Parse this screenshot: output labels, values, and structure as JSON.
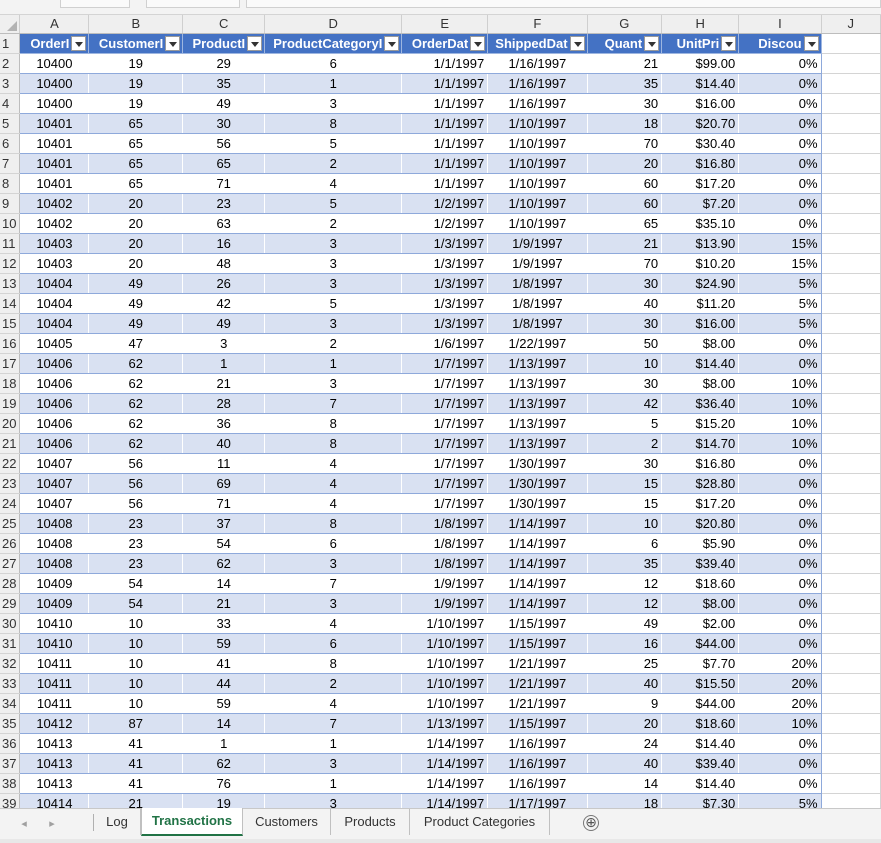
{
  "columns": [
    "A",
    "B",
    "C",
    "D",
    "E",
    "F",
    "G",
    "H",
    "I",
    "J"
  ],
  "headers": [
    "OrderI",
    "CustomerI",
    "ProductI",
    "ProductCategoryI",
    "OrderDat",
    "ShippedDat",
    "Quant",
    "UnitPri",
    "Discou"
  ],
  "rows": [
    [
      "10400",
      "19",
      "29",
      "6",
      "1/1/1997",
      "1/16/1997",
      "21",
      "$99.00",
      "0%"
    ],
    [
      "10400",
      "19",
      "35",
      "1",
      "1/1/1997",
      "1/16/1997",
      "35",
      "$14.40",
      "0%"
    ],
    [
      "10400",
      "19",
      "49",
      "3",
      "1/1/1997",
      "1/16/1997",
      "30",
      "$16.00",
      "0%"
    ],
    [
      "10401",
      "65",
      "30",
      "8",
      "1/1/1997",
      "1/10/1997",
      "18",
      "$20.70",
      "0%"
    ],
    [
      "10401",
      "65",
      "56",
      "5",
      "1/1/1997",
      "1/10/1997",
      "70",
      "$30.40",
      "0%"
    ],
    [
      "10401",
      "65",
      "65",
      "2",
      "1/1/1997",
      "1/10/1997",
      "20",
      "$16.80",
      "0%"
    ],
    [
      "10401",
      "65",
      "71",
      "4",
      "1/1/1997",
      "1/10/1997",
      "60",
      "$17.20",
      "0%"
    ],
    [
      "10402",
      "20",
      "23",
      "5",
      "1/2/1997",
      "1/10/1997",
      "60",
      "$7.20",
      "0%"
    ],
    [
      "10402",
      "20",
      "63",
      "2",
      "1/2/1997",
      "1/10/1997",
      "65",
      "$35.10",
      "0%"
    ],
    [
      "10403",
      "20",
      "16",
      "3",
      "1/3/1997",
      "1/9/1997",
      "21",
      "$13.90",
      "15%"
    ],
    [
      "10403",
      "20",
      "48",
      "3",
      "1/3/1997",
      "1/9/1997",
      "70",
      "$10.20",
      "15%"
    ],
    [
      "10404",
      "49",
      "26",
      "3",
      "1/3/1997",
      "1/8/1997",
      "30",
      "$24.90",
      "5%"
    ],
    [
      "10404",
      "49",
      "42",
      "5",
      "1/3/1997",
      "1/8/1997",
      "40",
      "$11.20",
      "5%"
    ],
    [
      "10404",
      "49",
      "49",
      "3",
      "1/3/1997",
      "1/8/1997",
      "30",
      "$16.00",
      "5%"
    ],
    [
      "10405",
      "47",
      "3",
      "2",
      "1/6/1997",
      "1/22/1997",
      "50",
      "$8.00",
      "0%"
    ],
    [
      "10406",
      "62",
      "1",
      "1",
      "1/7/1997",
      "1/13/1997",
      "10",
      "$14.40",
      "0%"
    ],
    [
      "10406",
      "62",
      "21",
      "3",
      "1/7/1997",
      "1/13/1997",
      "30",
      "$8.00",
      "10%"
    ],
    [
      "10406",
      "62",
      "28",
      "7",
      "1/7/1997",
      "1/13/1997",
      "42",
      "$36.40",
      "10%"
    ],
    [
      "10406",
      "62",
      "36",
      "8",
      "1/7/1997",
      "1/13/1997",
      "5",
      "$15.20",
      "10%"
    ],
    [
      "10406",
      "62",
      "40",
      "8",
      "1/7/1997",
      "1/13/1997",
      "2",
      "$14.70",
      "10%"
    ],
    [
      "10407",
      "56",
      "11",
      "4",
      "1/7/1997",
      "1/30/1997",
      "30",
      "$16.80",
      "0%"
    ],
    [
      "10407",
      "56",
      "69",
      "4",
      "1/7/1997",
      "1/30/1997",
      "15",
      "$28.80",
      "0%"
    ],
    [
      "10407",
      "56",
      "71",
      "4",
      "1/7/1997",
      "1/30/1997",
      "15",
      "$17.20",
      "0%"
    ],
    [
      "10408",
      "23",
      "37",
      "8",
      "1/8/1997",
      "1/14/1997",
      "10",
      "$20.80",
      "0%"
    ],
    [
      "10408",
      "23",
      "54",
      "6",
      "1/8/1997",
      "1/14/1997",
      "6",
      "$5.90",
      "0%"
    ],
    [
      "10408",
      "23",
      "62",
      "3",
      "1/8/1997",
      "1/14/1997",
      "35",
      "$39.40",
      "0%"
    ],
    [
      "10409",
      "54",
      "14",
      "7",
      "1/9/1997",
      "1/14/1997",
      "12",
      "$18.60",
      "0%"
    ],
    [
      "10409",
      "54",
      "21",
      "3",
      "1/9/1997",
      "1/14/1997",
      "12",
      "$8.00",
      "0%"
    ],
    [
      "10410",
      "10",
      "33",
      "4",
      "1/10/1997",
      "1/15/1997",
      "49",
      "$2.00",
      "0%"
    ],
    [
      "10410",
      "10",
      "59",
      "6",
      "1/10/1997",
      "1/15/1997",
      "16",
      "$44.00",
      "0%"
    ],
    [
      "10411",
      "10",
      "41",
      "8",
      "1/10/1997",
      "1/21/1997",
      "25",
      "$7.70",
      "20%"
    ],
    [
      "10411",
      "10",
      "44",
      "2",
      "1/10/1997",
      "1/21/1997",
      "40",
      "$15.50",
      "20%"
    ],
    [
      "10411",
      "10",
      "59",
      "4",
      "1/10/1997",
      "1/21/1997",
      "9",
      "$44.00",
      "20%"
    ],
    [
      "10412",
      "87",
      "14",
      "7",
      "1/13/1997",
      "1/15/1997",
      "20",
      "$18.60",
      "10%"
    ],
    [
      "10413",
      "41",
      "1",
      "1",
      "1/14/1997",
      "1/16/1997",
      "24",
      "$14.40",
      "0%"
    ],
    [
      "10413",
      "41",
      "62",
      "3",
      "1/14/1997",
      "1/16/1997",
      "40",
      "$39.40",
      "0%"
    ],
    [
      "10413",
      "41",
      "76",
      "1",
      "1/14/1997",
      "1/16/1997",
      "14",
      "$14.40",
      "0%"
    ],
    [
      "10414",
      "21",
      "19",
      "3",
      "1/14/1997",
      "1/17/1997",
      "18",
      "$7.30",
      "5%"
    ]
  ],
  "sheet_tabs": {
    "log": "Log",
    "transactions": "Transactions",
    "customers": "Customers",
    "products": "Products",
    "product_categories": "Product Categories",
    "active": "Transactions"
  },
  "nav_prev_icon": "◂",
  "nav_next_icon": "▸",
  "add_sheet_icon": "⊕",
  "colors": {
    "header_blue": "#4472c4",
    "band_blue": "#d9e1f2",
    "active_tab_green": "#217346"
  }
}
